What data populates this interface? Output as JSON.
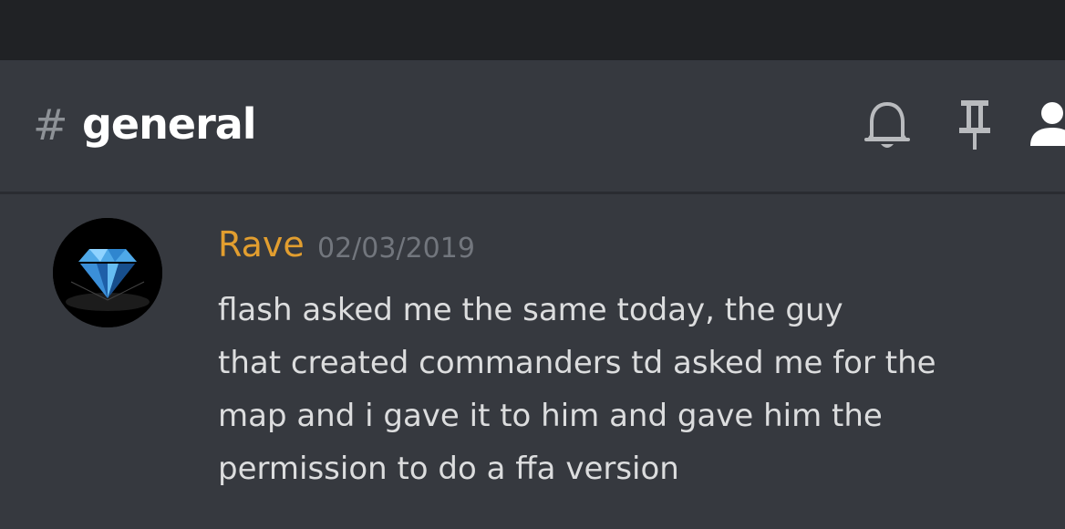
{
  "channel": {
    "hash_symbol": "#",
    "name": "general"
  },
  "header_icons": [
    "bell-icon",
    "pin-icon",
    "members-icon"
  ],
  "message": {
    "username": "Rave",
    "username_color": "#e29e2f",
    "timestamp": "02/03/2019",
    "avatar": "diamond-avatar",
    "lines": [
      "flash asked me the same today, the guy",
      "that created commanders td asked me for the",
      "map and i gave it to him and gave him the",
      "permission to do a ffa version"
    ]
  },
  "colors": {
    "background": "#36393f",
    "statusbar": "#202225",
    "text": "#dcddde",
    "muted": "#72767d"
  }
}
